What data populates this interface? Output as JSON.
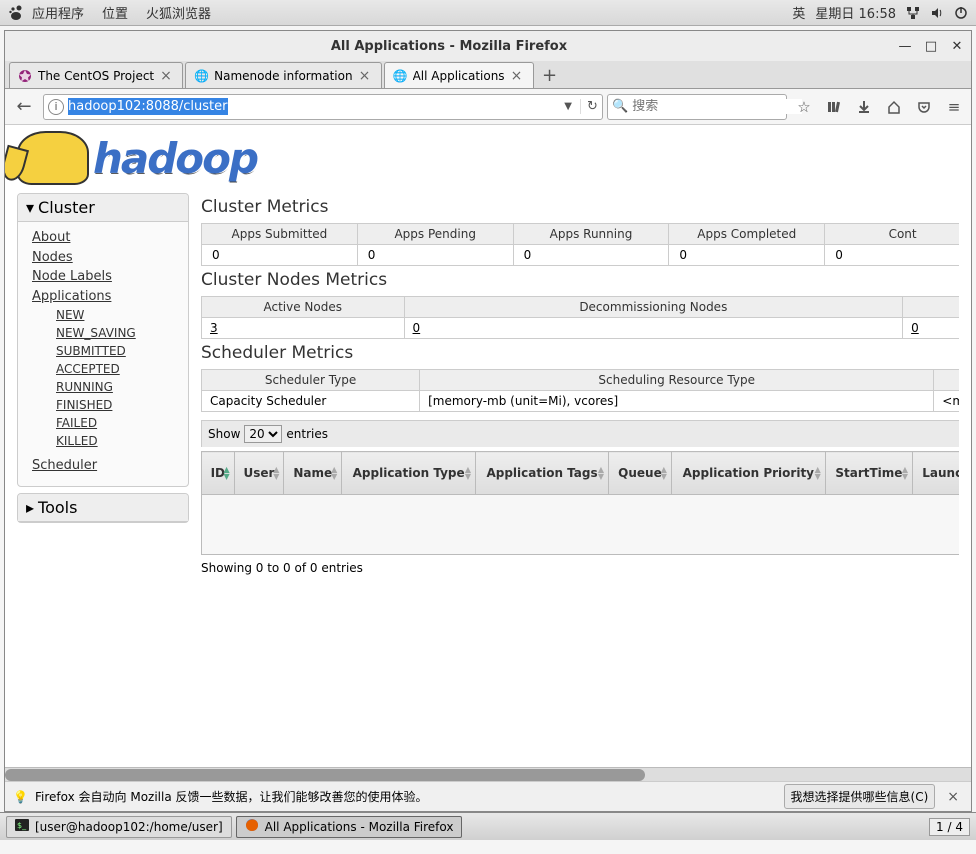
{
  "gnome": {
    "menus": [
      "应用程序",
      "位置",
      "火狐浏览器"
    ],
    "input": "英",
    "date": "星期日 16:58"
  },
  "firefox": {
    "title": "All Applications - Mozilla Firefox",
    "tabs": [
      {
        "label": "The CentOS Project"
      },
      {
        "label": "Namenode information"
      },
      {
        "label": "All Applications"
      }
    ],
    "url_selected": "hadoop102:8088/cluster",
    "search_placeholder": "搜索",
    "notif_msg": "Firefox 会自动向 Mozilla 反馈一些数据，让我们能够改善您的使用体验。",
    "notif_action": "我想选择提供哪些信息(C)"
  },
  "page": {
    "logo_text": "hadoop",
    "sidebar": {
      "cluster": {
        "title": "Cluster",
        "links": [
          "About",
          "Nodes",
          "Node Labels",
          "Applications"
        ],
        "app_states": [
          "NEW",
          "NEW_SAVING",
          "SUBMITTED",
          "ACCEPTED",
          "RUNNING",
          "FINISHED",
          "FAILED",
          "KILLED"
        ],
        "scheduler": "Scheduler"
      },
      "tools": {
        "title": "Tools"
      }
    },
    "cluster_metrics": {
      "title": "Cluster Metrics",
      "headers": [
        "Apps Submitted",
        "Apps Pending",
        "Apps Running",
        "Apps Completed",
        "Cont"
      ],
      "values": [
        "0",
        "0",
        "0",
        "0",
        "0"
      ]
    },
    "nodes_metrics": {
      "title": "Cluster Nodes Metrics",
      "headers": [
        "Active Nodes",
        "Decommissioning Nodes",
        ""
      ],
      "values": [
        "3",
        "0",
        "0"
      ]
    },
    "scheduler_metrics": {
      "title": "Scheduler Metrics",
      "headers": [
        "Scheduler Type",
        "Scheduling Resource Type",
        ""
      ],
      "values": [
        "Capacity Scheduler",
        "[memory-mb (unit=Mi), vcores]",
        "<m"
      ]
    },
    "apps_table": {
      "show_label_pre": "Show",
      "show_value": "20",
      "show_label_post": "entries",
      "cols": [
        "ID",
        "User",
        "Name",
        "Application Type",
        "Application Tags",
        "Queue",
        "Application Priority",
        "StartTime",
        "Launch"
      ],
      "footer": "Showing 0 to 0 of 0 entries"
    }
  },
  "taskbar": {
    "term": "[user@hadoop102:/home/user]",
    "ff": "All Applications - Mozilla Firefox",
    "ws": "1 / 4"
  }
}
